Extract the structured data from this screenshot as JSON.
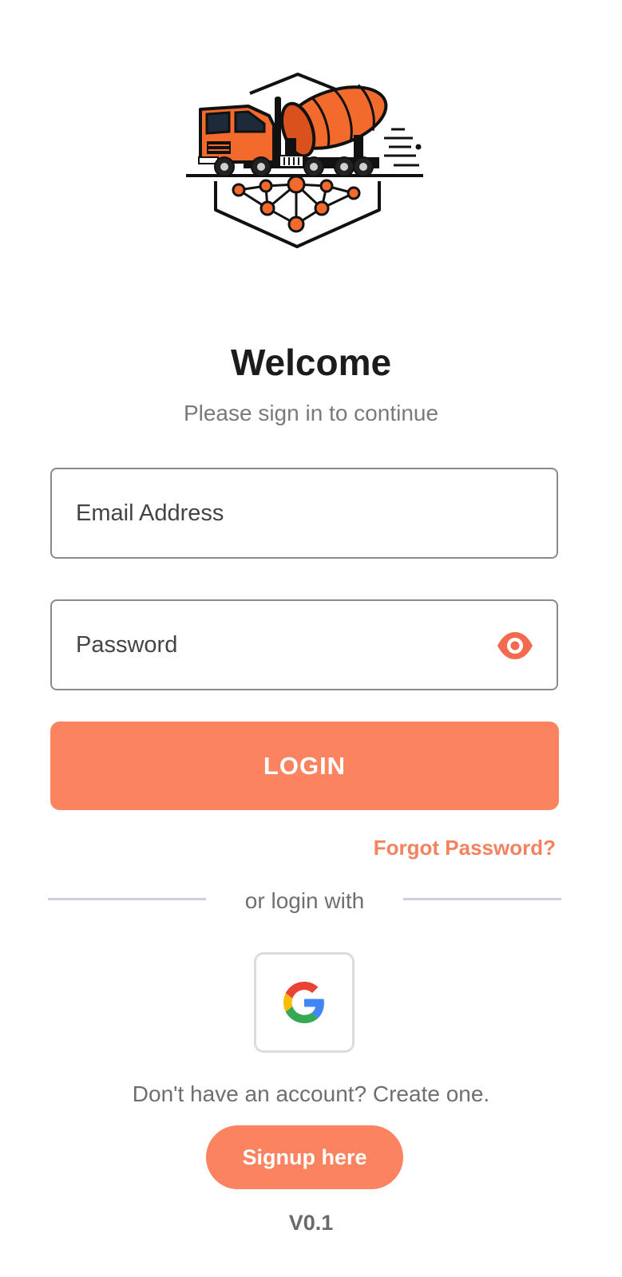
{
  "logo": {
    "icon": "concrete-mixer-truck-network-logo"
  },
  "header": {
    "title": "Welcome",
    "subtitle": "Please sign in to continue"
  },
  "form": {
    "email_placeholder": "Email Address",
    "password_placeholder": "Password",
    "show_password_icon": "eye-icon",
    "login_label": "LOGIN",
    "forgot_label": "Forgot Password?"
  },
  "social": {
    "divider_text": "or login with",
    "google_icon": "google-icon"
  },
  "signup": {
    "prompt": "Don't have an account? Create one.",
    "button_label": "Signup here"
  },
  "footer": {
    "version": "V0.1"
  },
  "colors": {
    "accent": "#fb8360",
    "accent_text": "#f4825e",
    "muted_text": "#7a7a7a",
    "border": "#8a8a8a"
  }
}
